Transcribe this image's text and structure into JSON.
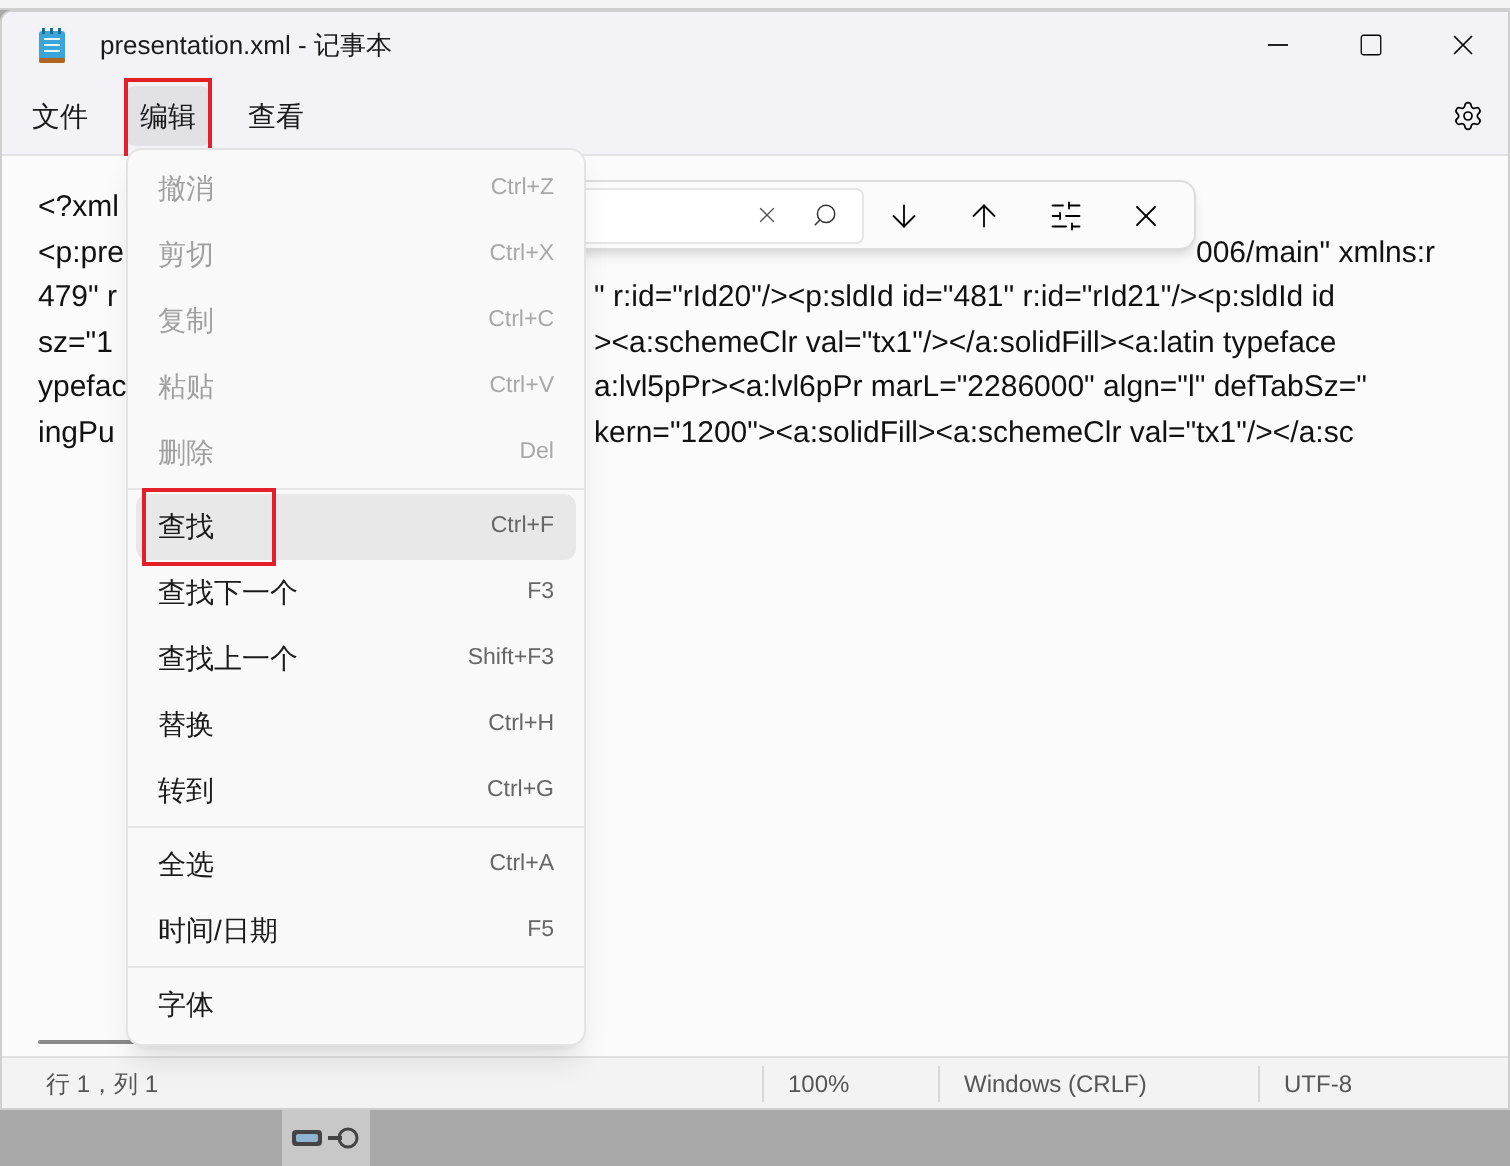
{
  "window": {
    "title": "presentation.xml - 记事本"
  },
  "menu_bar": [
    {
      "label": "文件",
      "selected": false,
      "annotated": false
    },
    {
      "label": "编辑",
      "selected": true,
      "annotated": true
    },
    {
      "label": "查看",
      "selected": false,
      "annotated": false
    }
  ],
  "editor_lines": [
    {
      "kind": "under_find_bar",
      "left": "<?xml"
    },
    {
      "kind": "under_find_bar",
      "left": "<p:pre",
      "right": "006/main\" xmlns:r"
    },
    {
      "kind": "under_menu",
      "left": "479\" r",
      "right": "\" r:id=\"rId20\"/><p:sldId id=\"481\" r:id=\"rId21\"/><p:sldId id"
    },
    {
      "kind": "under_menu",
      "left": " sz=\"1",
      "right": "><a:schemeClr val=\"tx1\"/></a:solidFill><a:latin typeface"
    },
    {
      "kind": "under_menu",
      "left": "ypefac",
      "right": "a:lvl5pPr><a:lvl6pPr marL=\"2286000\" algn=\"l\" defTabSz=\""
    },
    {
      "kind": "under_menu",
      "left": "ingPu",
      "right": "kern=\"1200\"><a:solidFill><a:schemeClr val=\"tx1\"/></a:sc"
    }
  ],
  "edit_menu": {
    "groups": [
      {
        "items": [
          {
            "label": "撤消",
            "shortcut": "Ctrl+Z",
            "disabled": true,
            "selected": false,
            "annotated": false
          },
          {
            "label": "剪切",
            "shortcut": "Ctrl+X",
            "disabled": true,
            "selected": false,
            "annotated": false
          },
          {
            "label": "复制",
            "shortcut": "Ctrl+C",
            "disabled": true,
            "selected": false,
            "annotated": false
          },
          {
            "label": "粘贴",
            "shortcut": "Ctrl+V",
            "disabled": true,
            "selected": false,
            "annotated": false
          },
          {
            "label": "删除",
            "shortcut": "Del",
            "disabled": true,
            "selected": false,
            "annotated": false
          }
        ]
      },
      {
        "items": [
          {
            "label": "查找",
            "shortcut": "Ctrl+F",
            "disabled": false,
            "selected": true,
            "annotated": true
          },
          {
            "label": "查找下一个",
            "shortcut": "F3",
            "disabled": false,
            "selected": false,
            "annotated": false
          },
          {
            "label": "查找上一个",
            "shortcut": "Shift+F3",
            "disabled": false,
            "selected": false,
            "annotated": false
          },
          {
            "label": "替换",
            "shortcut": "Ctrl+H",
            "disabled": false,
            "selected": false,
            "annotated": false
          },
          {
            "label": "转到",
            "shortcut": "Ctrl+G",
            "disabled": false,
            "selected": false,
            "annotated": false
          }
        ]
      },
      {
        "items": [
          {
            "label": "全选",
            "shortcut": "Ctrl+A",
            "disabled": false,
            "selected": false,
            "annotated": false
          },
          {
            "label": "时间/日期",
            "shortcut": "F5",
            "disabled": false,
            "selected": false,
            "annotated": false
          }
        ]
      },
      {
        "items": [
          {
            "label": "字体",
            "disabled": false,
            "selected": false,
            "annotated": false
          }
        ]
      }
    ]
  },
  "status_bar": {
    "position": "行 1，列 1",
    "zoom": "100%",
    "line_ending": "Windows (CRLF)",
    "encoding": "UTF-8"
  }
}
